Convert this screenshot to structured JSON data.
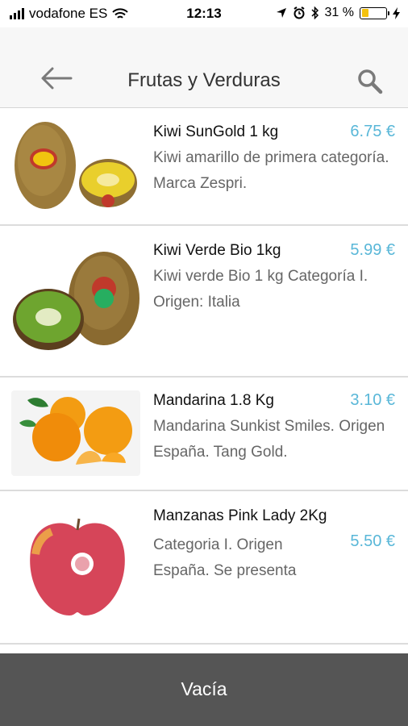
{
  "status_bar": {
    "carrier": "vodafone ES",
    "time": "12:13",
    "battery_percent_label": "31 %",
    "battery_level": 0.31
  },
  "header": {
    "title": "Frutas y Verduras",
    "back_icon": "back-arrow-icon",
    "search_icon": "search-icon"
  },
  "products": [
    {
      "name": "Kiwi SunGold 1 kg",
      "price": "6.75 €",
      "description": "Kiwi amarillo de primera categoría. Marca Zespri.",
      "image": "kiwi-sungold-image"
    },
    {
      "name": "Kiwi Verde Bio 1kg",
      "price": "5.99 €",
      "description": "Kiwi verde Bio 1 kg Categoría I. Origen: Italia",
      "image": "kiwi-verde-image"
    },
    {
      "name": "Mandarina 1.8 Kg",
      "price": "3.10 €",
      "description": "Mandarina Sunkist Smiles. Origen España. Tang Gold.",
      "image": "mandarina-image"
    },
    {
      "name": "Manzanas Pink Lady 2Kg",
      "price": "5.50 €",
      "description": "Categoria I. Origen España. Se presenta",
      "image": "pink-lady-image"
    }
  ],
  "footer": {
    "button_label": "Vacía"
  },
  "colors": {
    "price": "#59b7d8",
    "footer_bg": "#555555",
    "header_bg": "#f7f7f7",
    "battery": "#f4c20d"
  }
}
